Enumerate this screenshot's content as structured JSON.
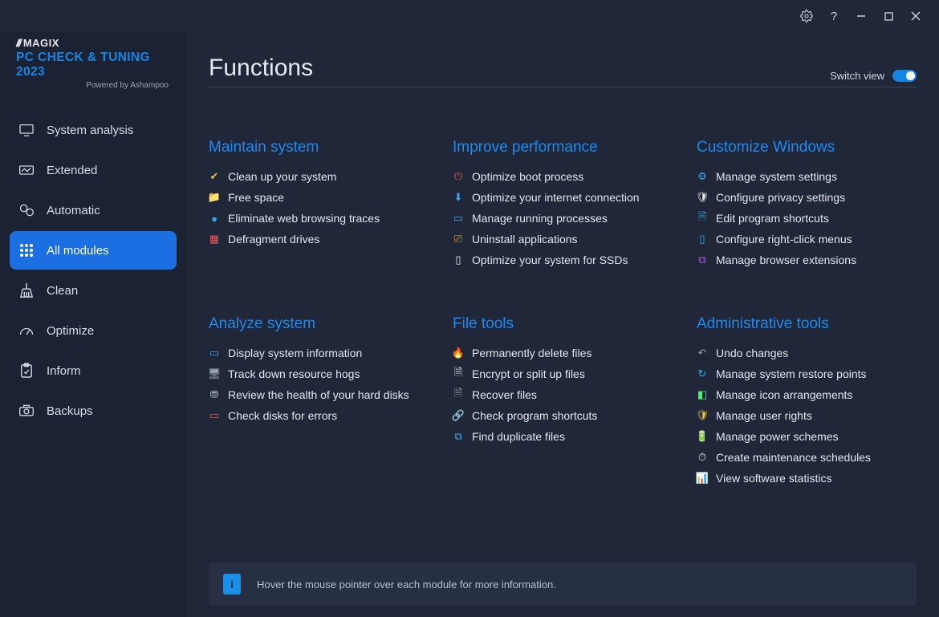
{
  "brand": {
    "magix": "MAGIX",
    "title": "PC CHECK & TUNING 2023",
    "subtitle": "Powered by Ashampoo"
  },
  "header": {
    "title": "Functions",
    "switch_label": "Switch view"
  },
  "sidebar": {
    "items": [
      {
        "label": "System analysis"
      },
      {
        "label": "Extended"
      },
      {
        "label": "Automatic"
      },
      {
        "label": "All modules"
      },
      {
        "label": "Clean"
      },
      {
        "label": "Optimize"
      },
      {
        "label": "Inform"
      },
      {
        "label": "Backups"
      }
    ]
  },
  "groups": [
    {
      "title": "Maintain system",
      "modules": [
        {
          "icon": "✔",
          "color": "#e6c23a",
          "label": "Clean up your system"
        },
        {
          "icon": "📁",
          "color": "#e6a33a",
          "label": "Free space"
        },
        {
          "icon": "●",
          "color": "#2aa8e8",
          "label": "Eliminate web browsing traces"
        },
        {
          "icon": "▦",
          "color": "#e85a5a",
          "label": "Defragment drives"
        }
      ]
    },
    {
      "title": "Improve performance",
      "modules": [
        {
          "icon": "⏻",
          "color": "#e05a5a",
          "label": "Optimize boot process"
        },
        {
          "icon": "⬇",
          "color": "#3aa8e8",
          "label": "Optimize your internet connection"
        },
        {
          "icon": "▭",
          "color": "#3aa8e8",
          "label": "Manage running processes"
        },
        {
          "icon": "⎚",
          "color": "#e6a33a",
          "label": "Uninstall applications"
        },
        {
          "icon": "▯",
          "color": "#e6e6e6",
          "label": "Optimize your system for SSDs"
        }
      ]
    },
    {
      "title": "Customize Windows",
      "modules": [
        {
          "icon": "⚙",
          "color": "#3aa8e8",
          "label": "Manage system settings"
        },
        {
          "icon": "🛡",
          "color": "#e6e6e6",
          "label": "Configure privacy settings"
        },
        {
          "icon": "🗎",
          "color": "#3aa8e8",
          "label": "Edit program shortcuts"
        },
        {
          "icon": "▯",
          "color": "#3aa8e8",
          "label": "Configure right-click menus"
        },
        {
          "icon": "⧉",
          "color": "#a85ae8",
          "label": "Manage browser extensions"
        }
      ]
    },
    {
      "title": "Analyze system",
      "modules": [
        {
          "icon": "▭",
          "color": "#3aa8e8",
          "label": "Display system information"
        },
        {
          "icon": "🖥",
          "color": "#9aa3b5",
          "label": "Track down resource hogs"
        },
        {
          "icon": "⛃",
          "color": "#9aa3b5",
          "label": "Review the health of your hard disks"
        },
        {
          "icon": "▭",
          "color": "#e85a5a",
          "label": "Check disks for errors"
        }
      ]
    },
    {
      "title": "File tools",
      "modules": [
        {
          "icon": "🔥",
          "color": "#e85a5a",
          "label": "Permanently delete files"
        },
        {
          "icon": "🗎",
          "color": "#e6e6e6",
          "label": "Encrypt or split up files"
        },
        {
          "icon": "🗎",
          "color": "#9aa3b5",
          "label": "Recover files"
        },
        {
          "icon": "🔗",
          "color": "#3aa8e8",
          "label": "Check program shortcuts"
        },
        {
          "icon": "⧉",
          "color": "#3aa8e8",
          "label": "Find duplicate files"
        }
      ]
    },
    {
      "title": "Administrative tools",
      "modules": [
        {
          "icon": "↶",
          "color": "#9aa3b5",
          "label": "Undo changes"
        },
        {
          "icon": "↻",
          "color": "#3aa8e8",
          "label": "Manage system restore points"
        },
        {
          "icon": "◧",
          "color": "#5ae87a",
          "label": "Manage icon arrangements"
        },
        {
          "icon": "🛡",
          "color": "#e6c23a",
          "label": "Manage user rights"
        },
        {
          "icon": "🔋",
          "color": "#3aa8e8",
          "label": "Manage power schemes"
        },
        {
          "icon": "⏱",
          "color": "#e6e6e6",
          "label": "Create maintenance schedules"
        },
        {
          "icon": "📊",
          "color": "#3aa8e8",
          "label": "View software statistics"
        }
      ]
    }
  ],
  "hint": "Hover the mouse pointer over each module for more information."
}
